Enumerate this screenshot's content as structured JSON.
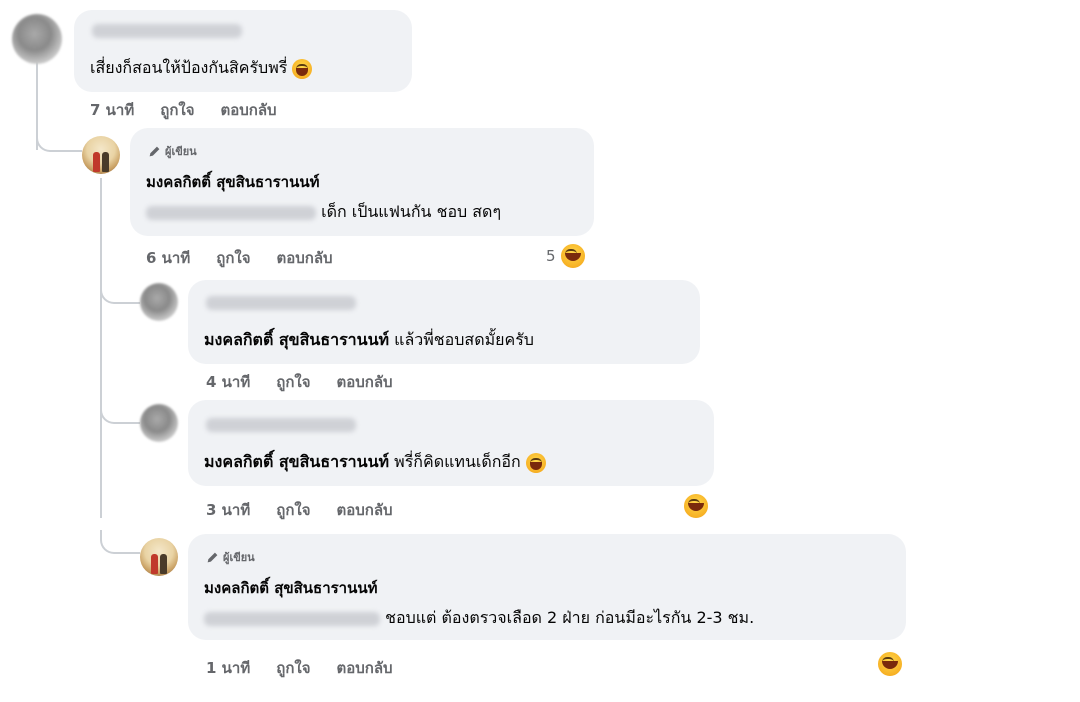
{
  "author_badge": "ผู้เขียน",
  "author_name": "มงคลกิตติ์ สุขสินธารานนท์",
  "actions": {
    "like": "ถูกใจ",
    "reply": "ตอบกลับ"
  },
  "comments": [
    {
      "time": "7 นาที",
      "text": "เสี่ยงก็สอนให้ป้องกันสิครับพรี่",
      "emoji": "laughing-emoji"
    },
    {
      "time": "6 นาที",
      "text_suffix": "เด็ก เป็นแฟนกัน ชอบ สดๆ",
      "reaction_count": "5",
      "reaction_icon": "haha-reaction-icon"
    },
    {
      "time": "4 นาที",
      "mention": "มงคลกิตติ์ สุขสินธารานนท์",
      "text": "แล้วพี่ชอบสดมั้ยครับ"
    },
    {
      "time": "3 นาที",
      "mention": "มงคลกิตติ์ สุขสินธารานนท์",
      "text": "พรี่ก็คิดแทนเด็กอีก",
      "emoji": "laughing-emoji",
      "reaction_icon": "haha-reaction-icon"
    },
    {
      "time": "1 นาที",
      "text_suffix": "ชอบแต่ ต้องตรวจเลือด 2 ฝ่าย ก่อนมีอะไรกัน 2-3 ชม.",
      "reaction_icon": "haha-reaction-icon"
    }
  ]
}
